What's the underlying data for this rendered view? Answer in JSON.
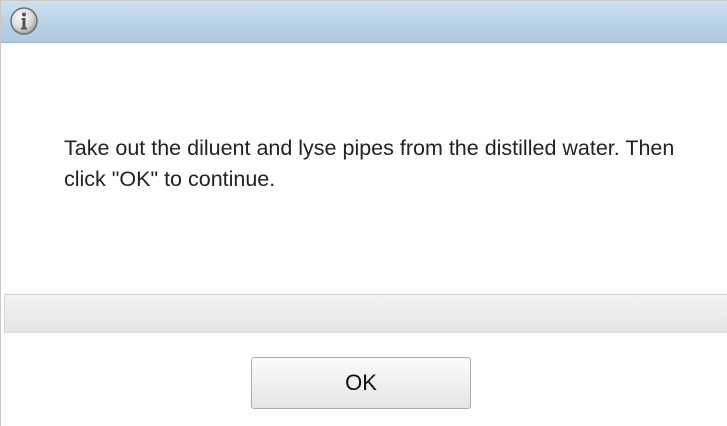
{
  "dialog": {
    "title_icon": "info-icon",
    "message": "Take out the diluent and lyse pipes from the distilled water. Then click \"OK\" to continue.",
    "ok_label": "OK"
  },
  "colors": {
    "titlebar": "#b9d2e7",
    "status_bar": "#e9e9e9",
    "button_border": "#adadad"
  }
}
